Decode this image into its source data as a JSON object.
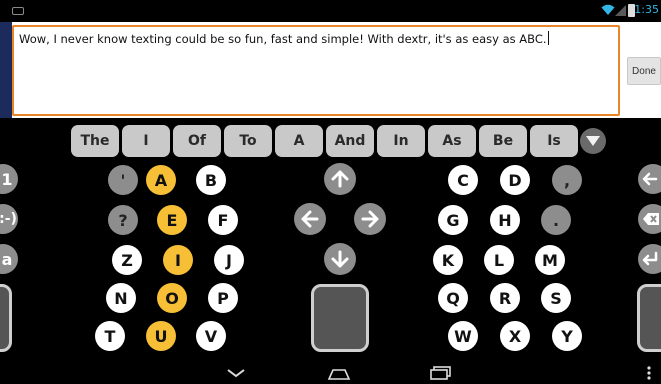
{
  "status_bar": {
    "time": "1:35"
  },
  "editor": {
    "text": "Wow, I never know texting could be so fun, fast and simple! With dextr, it's as easy as ABC.",
    "done_label": "Done"
  },
  "suggestions": [
    "The",
    "I",
    "Of",
    "To",
    "A",
    "And",
    "In",
    "As",
    "Be",
    "Is"
  ],
  "side_left": {
    "numbers_label": "1",
    "emoticon_label": ":-)",
    "case_label": "a"
  },
  "keys": {
    "apostrophe": "'",
    "question": "?",
    "comma": ",",
    "period": ".",
    "letters": [
      "A",
      "B",
      "E",
      "F",
      "I",
      "J",
      "O",
      "P",
      "U",
      "V",
      "Z",
      "N",
      "T",
      "C",
      "D",
      "G",
      "H",
      "K",
      "L",
      "M",
      "Q",
      "R",
      "S",
      "W",
      "X",
      "Y"
    ]
  },
  "icons": {
    "wifi": "wifi-icon",
    "signal": "signal-icon",
    "battery": "battery-icon",
    "backspace": "backspace-icon",
    "delete": "delete-icon",
    "enter": "enter-icon",
    "arrow_up": "arrow-up-icon",
    "arrow_down": "arrow-down-icon",
    "arrow_left": "arrow-left-icon",
    "arrow_right": "arrow-right-icon",
    "nav_back": "chevron-down-icon",
    "nav_home": "home-icon",
    "nav_recents": "recents-icon",
    "nav_menu": "overflow-menu-icon"
  },
  "colors": {
    "accent_orange": "#e8852a",
    "vowel_yellow": "#f6bf36",
    "status_blue": "#33b5e5",
    "key_white": "#ffffff",
    "key_gray": "#8d8d8d",
    "suggestion_gray": "#c9c9c9"
  }
}
